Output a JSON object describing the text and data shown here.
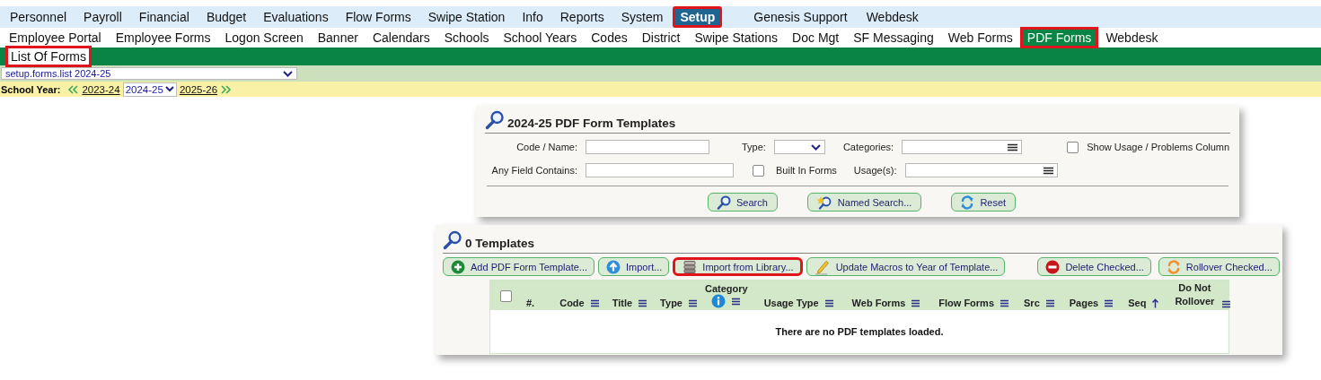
{
  "main_menu": {
    "items": [
      {
        "label": "Personnel",
        "selected": false,
        "highlighted": false
      },
      {
        "label": "Payroll",
        "selected": false,
        "highlighted": false
      },
      {
        "label": "Financial",
        "selected": false,
        "highlighted": false
      },
      {
        "label": "Budget",
        "selected": false,
        "highlighted": false
      },
      {
        "label": "Evaluations",
        "selected": false,
        "highlighted": false
      },
      {
        "label": "Flow Forms",
        "selected": false,
        "highlighted": false
      },
      {
        "label": "Swipe Station",
        "selected": false,
        "highlighted": false
      },
      {
        "label": "Info",
        "selected": false,
        "highlighted": false
      },
      {
        "label": "Reports",
        "selected": false,
        "highlighted": false
      },
      {
        "label": "System",
        "selected": false,
        "highlighted": false
      },
      {
        "label": "Setup",
        "selected": true,
        "highlighted": true
      }
    ],
    "extra_items": [
      {
        "label": "Genesis Support",
        "selected": false,
        "highlighted": false
      },
      {
        "label": "Webdesk",
        "selected": false,
        "highlighted": false
      }
    ]
  },
  "sub_menu": {
    "items": [
      {
        "label": "Employee Portal",
        "selected": false,
        "highlighted": false
      },
      {
        "label": "Employee Forms",
        "selected": false,
        "highlighted": false
      },
      {
        "label": "Logon Screen",
        "selected": false,
        "highlighted": false
      },
      {
        "label": "Banner",
        "selected": false,
        "highlighted": false
      },
      {
        "label": "Calendars",
        "selected": false,
        "highlighted": false
      },
      {
        "label": "Schools",
        "selected": false,
        "highlighted": false
      },
      {
        "label": "School Years",
        "selected": false,
        "highlighted": false
      },
      {
        "label": "Codes",
        "selected": false,
        "highlighted": false
      },
      {
        "label": "District",
        "selected": false,
        "highlighted": false
      },
      {
        "label": "Swipe Stations",
        "selected": false,
        "highlighted": false
      },
      {
        "label": "Doc Mgt",
        "selected": false,
        "highlighted": false
      },
      {
        "label": "SF Messaging",
        "selected": false,
        "highlighted": false
      },
      {
        "label": "Web Forms",
        "selected": false,
        "highlighted": false
      },
      {
        "label": "PDF Forms",
        "selected": true,
        "highlighted": true
      },
      {
        "label": "Webdesk",
        "selected": false,
        "highlighted": false
      }
    ]
  },
  "page_tabs": [
    {
      "label": "List Of Forms",
      "selected": true,
      "highlighted": true
    }
  ],
  "screen_select": {
    "value": "setup.forms.list 2024-25"
  },
  "school_year": {
    "label": "School Year:",
    "previous": "2023-24",
    "current": "2024-25",
    "next": "2025-26"
  },
  "search_panel": {
    "title": "2024-25 PDF Form Templates",
    "rows": [
      [
        {
          "kind": "text",
          "label": "Code / Name:"
        },
        {
          "kind": "select",
          "label": "Type:"
        },
        {
          "kind": "list",
          "label": "Categories:"
        },
        {
          "kind": "checkbox",
          "label": "Show Usage / Problems Column",
          "checked": false
        }
      ],
      [
        {
          "kind": "text",
          "label": "Any Field Contains:"
        },
        {
          "kind": "checkbox",
          "label": "Built In Forms",
          "checked": false
        },
        {
          "kind": "list",
          "label": "Usage(s):"
        }
      ]
    ],
    "buttons": [
      {
        "kind": "search",
        "label": "Search"
      },
      {
        "kind": "named",
        "label": "Named Search..."
      },
      {
        "kind": "reset",
        "label": "Reset"
      }
    ]
  },
  "templates_panel": {
    "title": "0 Templates",
    "buttons": [
      {
        "kind": "add",
        "label": "Add PDF Form Template...",
        "highlighted": false
      },
      {
        "kind": "import",
        "label": "Import...",
        "highlighted": false
      },
      {
        "kind": "library",
        "label": "Import from Library...",
        "highlighted": true
      },
      {
        "kind": "edit",
        "label": "Update Macros to Year of Template...",
        "highlighted": false
      },
      {
        "kind": "delete",
        "label": "Delete Checked...",
        "highlighted": false
      },
      {
        "kind": "rollover",
        "label": "Rollover Checked...",
        "highlighted": false
      }
    ],
    "table": {
      "columns": [
        {
          "kind": "checkbox",
          "checked": false
        },
        {
          "kind": "plain",
          "label": "#."
        },
        {
          "kind": "menu",
          "label": "Code"
        },
        {
          "kind": "menu",
          "label": "Title"
        },
        {
          "kind": "menu",
          "label": "Type"
        },
        {
          "kind": "info",
          "label": "Category"
        },
        {
          "kind": "menu",
          "label": "Usage Type"
        },
        {
          "kind": "menu",
          "label": "Web Forms"
        },
        {
          "kind": "menu",
          "label": "Flow Forms"
        },
        {
          "kind": "menu",
          "label": "Src"
        },
        {
          "kind": "menu",
          "label": "Pages"
        },
        {
          "kind": "sort",
          "label": "Seq"
        },
        {
          "kind": "menu",
          "label": "Do Not Rollover"
        }
      ],
      "empty_message": "There are no PDF templates loaded."
    }
  }
}
